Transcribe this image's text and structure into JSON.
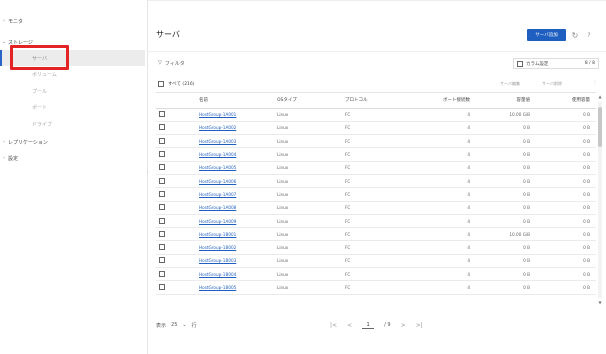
{
  "sidebar": {
    "items": [
      {
        "chevron": "›",
        "label": "モニタ"
      },
      {
        "chevron": "⌄",
        "label": "ストレージ"
      },
      {
        "chevron": "›",
        "label": "レプリケーション"
      },
      {
        "chevron": "›",
        "label": "設定"
      }
    ],
    "storage_sub": [
      "サーバ",
      "ボリューム",
      "プール",
      "ポート",
      "ドライブ"
    ],
    "collapse_glyph": "‹"
  },
  "header": {
    "title": "サーバ",
    "primary_button": "サーバ追加",
    "refresh_icon": "↻",
    "help_icon": "?"
  },
  "filter": {
    "icon": "▽",
    "label": "フィルタ"
  },
  "column_settings": {
    "label": "カラム設定",
    "count": "8 / 8"
  },
  "selection": {
    "label": "すべて (216)"
  },
  "toolbar": {
    "edit": "サーバ編集",
    "delete": "サーバ削除",
    "more": "⋮"
  },
  "table": {
    "columns": [
      "名前",
      "OSタイプ",
      "プロトコル",
      "ボート接続数",
      "容量値",
      "使用容量"
    ],
    "rows": [
      {
        "name": "HostGroup-1A001",
        "os": "Linux",
        "protocol": "FC",
        "ports": "4",
        "capacity": "10.00 GiB",
        "used": "0 B"
      },
      {
        "name": "HostGroup-1A002",
        "os": "Linux",
        "protocol": "FC",
        "ports": "4",
        "capacity": "0 B",
        "used": "0 B"
      },
      {
        "name": "HostGroup-1A003",
        "os": "Linux",
        "protocol": "FC",
        "ports": "4",
        "capacity": "0 B",
        "used": "0 B"
      },
      {
        "name": "HostGroup-1A004",
        "os": "Linux",
        "protocol": "FC",
        "ports": "4",
        "capacity": "0 B",
        "used": "0 B"
      },
      {
        "name": "HostGroup-1A005",
        "os": "Linux",
        "protocol": "FC",
        "ports": "4",
        "capacity": "0 B",
        "used": "0 B"
      },
      {
        "name": "HostGroup-1A006",
        "os": "Linux",
        "protocol": "FC",
        "ports": "4",
        "capacity": "0 B",
        "used": "0 B"
      },
      {
        "name": "HostGroup-1A007",
        "os": "Linux",
        "protocol": "FC",
        "ports": "4",
        "capacity": "0 B",
        "used": "0 B"
      },
      {
        "name": "HostGroup-1A008",
        "os": "Linux",
        "protocol": "FC",
        "ports": "4",
        "capacity": "0 B",
        "used": "0 B"
      },
      {
        "name": "HostGroup-1A009",
        "os": "Linux",
        "protocol": "FC",
        "ports": "4",
        "capacity": "0 B",
        "used": "0 B"
      },
      {
        "name": "HostGroup-1B001",
        "os": "Linux",
        "protocol": "FC",
        "ports": "4",
        "capacity": "10.00 GiB",
        "used": "0 B"
      },
      {
        "name": "HostGroup-1B002",
        "os": "Linux",
        "protocol": "FC",
        "ports": "4",
        "capacity": "0 B",
        "used": "0 B"
      },
      {
        "name": "HostGroup-1B003",
        "os": "Linux",
        "protocol": "FC",
        "ports": "4",
        "capacity": "0 B",
        "used": "0 B"
      },
      {
        "name": "HostGroup-1B004",
        "os": "Linux",
        "protocol": "FC",
        "ports": "4",
        "capacity": "0 B",
        "used": "0 B"
      },
      {
        "name": "HostGroup-1B005",
        "os": "Linux",
        "protocol": "FC",
        "ports": "4",
        "capacity": "0 B",
        "used": "0 B"
      }
    ]
  },
  "footer": {
    "show_label": "表示",
    "page_size": "25",
    "page_size_chevron": "⌄",
    "unit": "行",
    "first": "|<",
    "prev": "<",
    "current_page": "1",
    "total_pages": "/ 9",
    "next": ">",
    "last": ">|"
  },
  "colors": {
    "accent": "#1f5fbf",
    "highlight": "#e32424"
  }
}
